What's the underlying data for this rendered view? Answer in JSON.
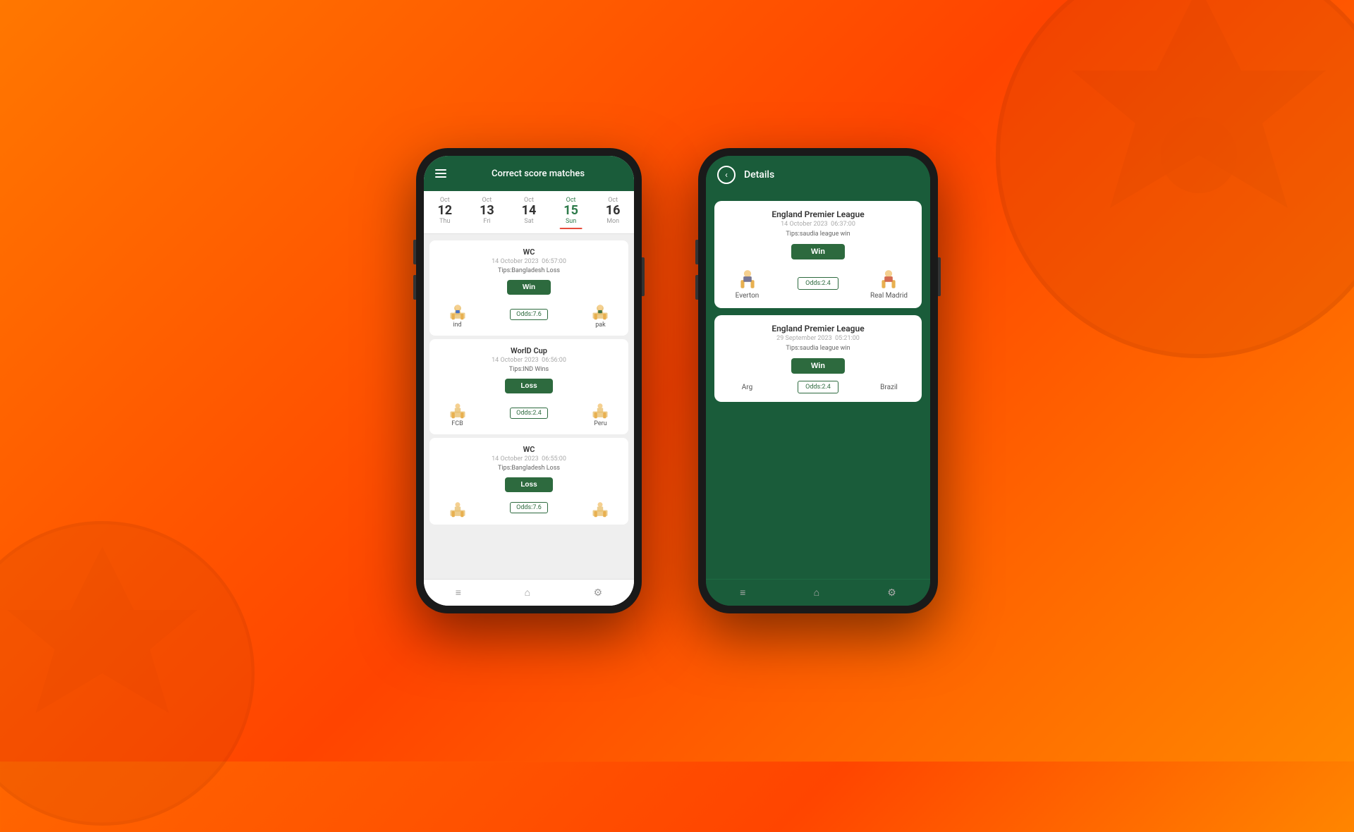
{
  "background": {
    "color_start": "#ff6600",
    "color_end": "#ff4500"
  },
  "phone1": {
    "header": {
      "title": "Correct score matches",
      "menu_icon": "menu-icon"
    },
    "date_tabs": [
      {
        "month": "Oct",
        "day": "12",
        "name": "Thu",
        "active": false
      },
      {
        "month": "Oct",
        "day": "13",
        "name": "Fri",
        "active": false
      },
      {
        "month": "Oct",
        "day": "14",
        "name": "Sat",
        "active": false
      },
      {
        "month": "Oct",
        "day": "15",
        "name": "Sun",
        "active": true
      },
      {
        "month": "Oct",
        "day": "16",
        "name": "Mon",
        "active": false
      }
    ],
    "matches": [
      {
        "league": "WC",
        "date": "14 October 2023",
        "time": "06:57:00",
        "tips": "Tips:Bangladesh Loss",
        "result": "Win",
        "result_type": "win",
        "odds": "Odds:7.6",
        "team1": "ind",
        "team2": "pak"
      },
      {
        "league": "WorlD Cup",
        "date": "14 October 2023",
        "time": "06:56:00",
        "tips": "Tips:IND Wins",
        "result": "Loss",
        "result_type": "loss",
        "odds": "Odds:2.4",
        "team1": "FCB",
        "team2": "Peru"
      },
      {
        "league": "WC",
        "date": "14 October 2023",
        "time": "06:55:00",
        "tips": "Tips:Bangladesh Loss",
        "result": "Loss",
        "result_type": "loss",
        "odds": "Odds:7.6",
        "team1": "",
        "team2": ""
      }
    ]
  },
  "phone2": {
    "header": {
      "title": "Details",
      "back_icon": "back-arrow"
    },
    "matches": [
      {
        "league": "England Premier League",
        "date": "14 October 2023",
        "time": "06:37:00",
        "tips": "Tips:saudia league win",
        "result": "Win",
        "result_type": "win",
        "odds": "Odds:2.4",
        "team1": "Everton",
        "team2": "Real Madrid"
      },
      {
        "league": "England Premier League",
        "date": "29 September 2023",
        "time": "05:21:00",
        "tips": "Tips:saudia league win",
        "result": "Win",
        "result_type": "win",
        "odds": "Odds:2.4",
        "team1": "Arg",
        "team2": "Brazil"
      }
    ]
  }
}
